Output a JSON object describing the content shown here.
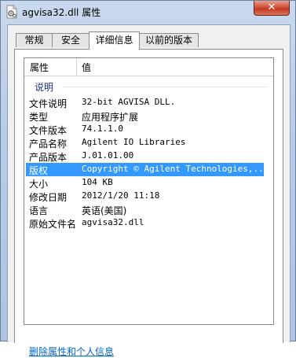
{
  "window": {
    "title": "agvisa32.dll 属性",
    "close_symbol": "✕"
  },
  "tabs": [
    {
      "label": "常规"
    },
    {
      "label": "安全"
    },
    {
      "label": "详细信息",
      "active": true
    },
    {
      "label": "以前的版本"
    }
  ],
  "details": {
    "columns": {
      "property": "属性",
      "value": "值"
    },
    "group": "说明",
    "rows": [
      {
        "property": "文件说明",
        "value": "32-bit AGVISA DLL."
      },
      {
        "property": "类型",
        "value": "应用程序扩展"
      },
      {
        "property": "文件版本",
        "value": "74.1.1.0"
      },
      {
        "property": "产品名称",
        "value": "Agilent IO Libraries"
      },
      {
        "property": "产品版本",
        "value": "J.01.01.00"
      },
      {
        "property": "版权",
        "value": "Copyright © Agilent Technologies,...",
        "selected": true
      },
      {
        "property": "大小",
        "value": "104 KB"
      },
      {
        "property": "修改日期",
        "value": "2012/1/20 11:18"
      },
      {
        "property": "语言",
        "value": "英语(美国)"
      },
      {
        "property": "原始文件名",
        "value": "agvisa32.dll"
      }
    ]
  },
  "footer": {
    "link_text": "删除属性和个人信息"
  },
  "colors": {
    "selection": "#3399ff",
    "group_text": "#1e3287",
    "link": "#0066cc"
  },
  "icons": {
    "title": "dll-file-icon",
    "close": "close-icon"
  }
}
